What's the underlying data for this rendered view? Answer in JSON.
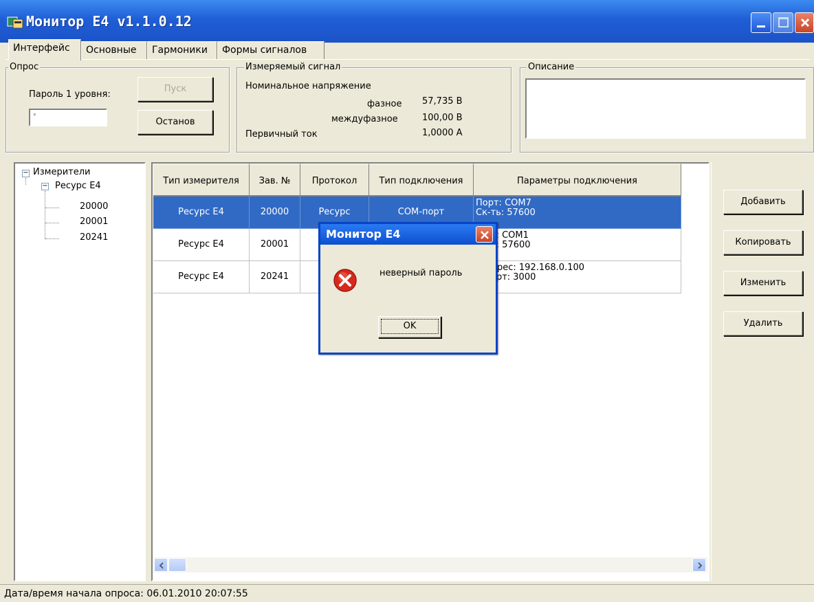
{
  "window": {
    "title": "Монитор E4 v1.1.0.12"
  },
  "tabs": [
    {
      "label": "Интерфейс"
    },
    {
      "label": "Основные"
    },
    {
      "label": "Гармоники"
    },
    {
      "label": "Формы сигналов"
    }
  ],
  "poll": {
    "group_label": "Опрос",
    "password_label": "Пароль 1 уровня:",
    "password_value": "*",
    "start_button": "Пуск",
    "stop_button": "Останов"
  },
  "signal": {
    "group_label": "Измеряемый сигнал",
    "nominal_voltage": "Номинальное напряжение",
    "phase_label": "фазное",
    "phase_value": "57,735 В",
    "interphase_label": "междуфазное",
    "interphase_value": "100,00 В",
    "primary_current": "Первичный ток",
    "primary_current_value": "1,0000 А"
  },
  "description": {
    "group_label": "Описание",
    "value": ""
  },
  "tree": {
    "root": "Измерители",
    "child": "Ресурс Е4",
    "leaves": [
      "20000",
      "20001",
      "20241"
    ]
  },
  "table": {
    "headers": [
      "Тип измерителя",
      "Зав. №",
      "Протокол",
      "Тип подключения",
      "Параметры подключения"
    ],
    "rows": [
      {
        "type": "Ресурс Е4",
        "serial": "20000",
        "protocol": "Ресурс",
        "connection": "COM-порт",
        "params_line1": "Порт:  COM7",
        "params_line2": "Ск-ть:  57600"
      },
      {
        "type": "Ресурс Е4",
        "serial": "20001",
        "protocol": "",
        "connection": "",
        "params_line1": "т:  COM1",
        "params_line2": "ь:  57600"
      },
      {
        "type": "Ресурс Е4",
        "serial": "20241",
        "protocol": "",
        "connection": "",
        "params_line1": "дрес:  192.168.0.100",
        "params_line2": "орт:     3000"
      }
    ]
  },
  "actions": {
    "add": "Добавить",
    "copy": "Копировать",
    "edit": "Изменить",
    "delete": "Удалить"
  },
  "dialog": {
    "title": "Монитор E4",
    "message": "неверный пароль",
    "ok": "OK"
  },
  "status": {
    "text": "Дата/время начала опроса: 06.01.2010 20:07:55"
  },
  "colors": {
    "selection": "#316ac5",
    "titlebar": "#1f5ed6",
    "error_icon": "#d8281b"
  }
}
